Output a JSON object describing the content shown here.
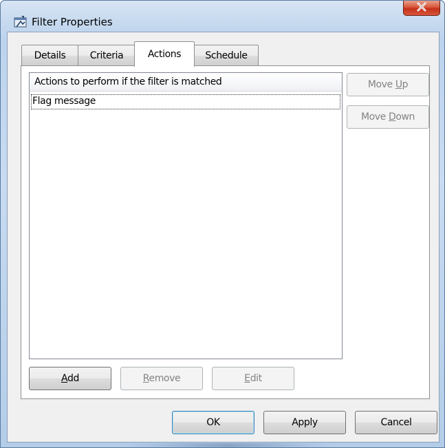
{
  "window": {
    "title": "Filter Properties",
    "close_symbol": "X"
  },
  "tabs": [
    {
      "label": "Details",
      "active": false
    },
    {
      "label": "Criteria",
      "active": false
    },
    {
      "label": "Actions",
      "active": true
    },
    {
      "label": "Schedule",
      "active": false
    }
  ],
  "actions_list": {
    "column_header": "Actions to perform if the filter is matched",
    "items": [
      "Flag message"
    ]
  },
  "side_buttons": {
    "move_up": {
      "before": "Move ",
      "mnemonic": "U",
      "after": "p"
    },
    "move_down": {
      "before": "Move ",
      "mnemonic": "D",
      "after": "own"
    }
  },
  "list_buttons": {
    "add": {
      "before": "",
      "mnemonic": "A",
      "after": "dd"
    },
    "remove": {
      "before": "",
      "mnemonic": "R",
      "after": "emove"
    },
    "edit": {
      "before": "",
      "mnemonic": "E",
      "after": "dit"
    }
  },
  "dialog_buttons": {
    "ok": "OK",
    "apply": "Apply",
    "cancel": "Cancel"
  },
  "colors": {
    "frame": "#bdd4ee",
    "client_bg": "#f0f0f0",
    "close_button": "#c4301a",
    "default_button_border": "#3c7fb1",
    "disabled_text": "#838383"
  }
}
